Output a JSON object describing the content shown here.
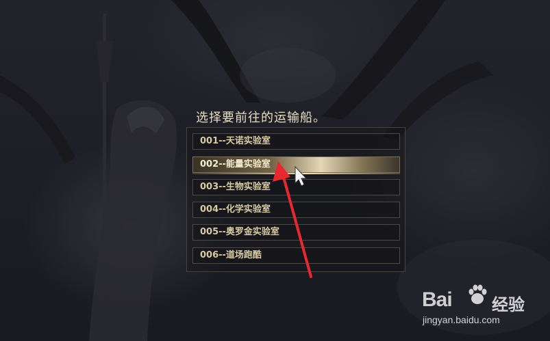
{
  "dialog": {
    "title": "选择要前往的运输船。",
    "options": [
      {
        "label": "001--天诺实验室"
      },
      {
        "label": "002--能量实验室"
      },
      {
        "label": "003--生物实验室"
      },
      {
        "label": "004--化学实验室"
      },
      {
        "label": "005--奥罗金实验室"
      },
      {
        "label": "006--道场跑酷"
      }
    ],
    "selected_index": 1
  },
  "annotation": {
    "arrow_color": "#e8272e"
  },
  "watermark": {
    "logo_text": "Bai",
    "logo_suffix": "",
    "brand": "经验",
    "url": "jingyan.baidu.com"
  }
}
